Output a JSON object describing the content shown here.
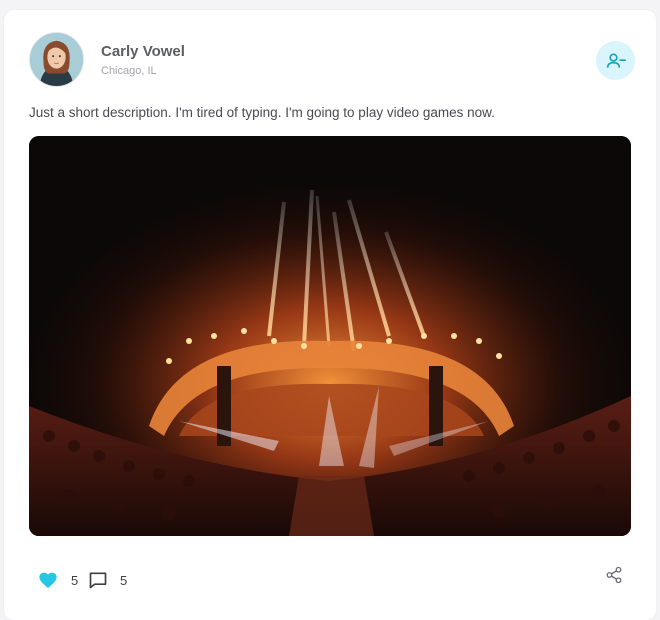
{
  "post": {
    "author": {
      "name": "Carly Vowel",
      "location": "Chicago, IL",
      "avatar": "avatar"
    },
    "description": "Just a short description. I'm tired of typing. I'm going to play video games now.",
    "image": "concert-stage-fireworks-photo",
    "likes": "5",
    "comments": "5",
    "icons": {
      "follow": "user-minus-icon",
      "like": "heart-icon",
      "comment": "comment-icon",
      "share": "share-icon"
    },
    "colors": {
      "accent": "#25c7e4",
      "follow_bg": "#d9f5fb",
      "text": "#4a4a52",
      "muted": "#a3a3ad"
    }
  }
}
